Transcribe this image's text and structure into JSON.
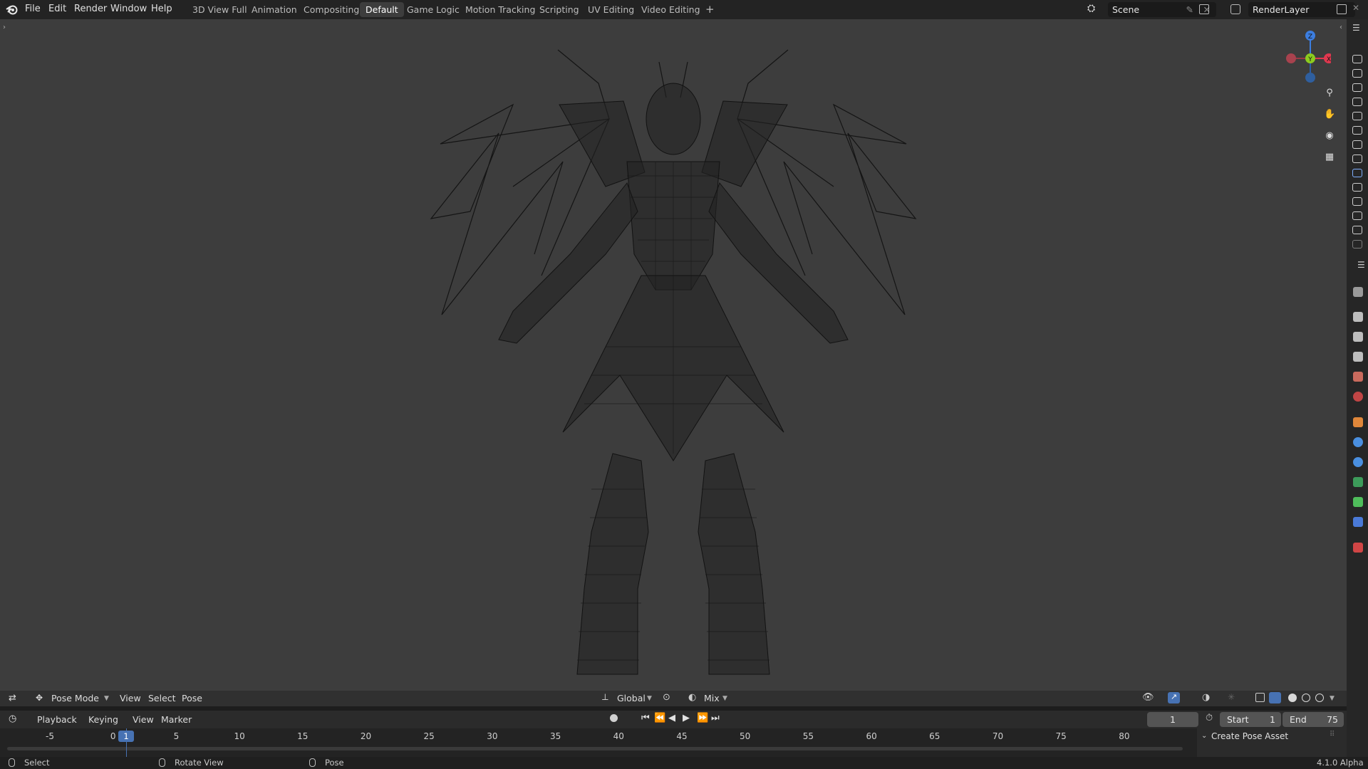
{
  "top_menu": [
    "File",
    "Edit",
    "Render",
    "Window",
    "Help"
  ],
  "workspaces": [
    "3D View Full",
    "Animation",
    "Compositing",
    "Default",
    "Game Logic",
    "Motion Tracking",
    "Scripting",
    "UV Editing",
    "Video Editing"
  ],
  "add_workspace_label": "+",
  "scene": {
    "name": "Scene"
  },
  "view_layer": {
    "name": "RenderLayer"
  },
  "gizmo": {
    "z": "Z",
    "y": "Y",
    "x": "X"
  },
  "viewport_header": {
    "mode": "Pose Mode",
    "menus": [
      "View",
      "Select",
      "Pose"
    ],
    "orientation": "Global",
    "blend": "Mix"
  },
  "timeline_header": {
    "menus": [
      "Playback",
      "Keying",
      "View",
      "Marker"
    ],
    "current_frame": "1",
    "start_label": "Start",
    "start_value": "1",
    "end_label": "End",
    "end_value": "75"
  },
  "timeline_ticks": [
    "-5",
    "0",
    "5",
    "10",
    "15",
    "20",
    "25",
    "30",
    "35",
    "40",
    "45",
    "50",
    "55",
    "60",
    "65",
    "70",
    "75",
    "80"
  ],
  "playhead_label": "1",
  "pose_panel": {
    "title": "Create Pose Asset"
  },
  "status_bar": {
    "select": "Select",
    "rotate": "Rotate View",
    "pose": "Pose",
    "version": "4.1.0 Alpha"
  },
  "colors": {
    "accent": "#4772b3",
    "x_axis": "#e0384f",
    "y_axis": "#8ccc1f",
    "z_axis": "#3c7ee0",
    "wire": "#141414"
  }
}
